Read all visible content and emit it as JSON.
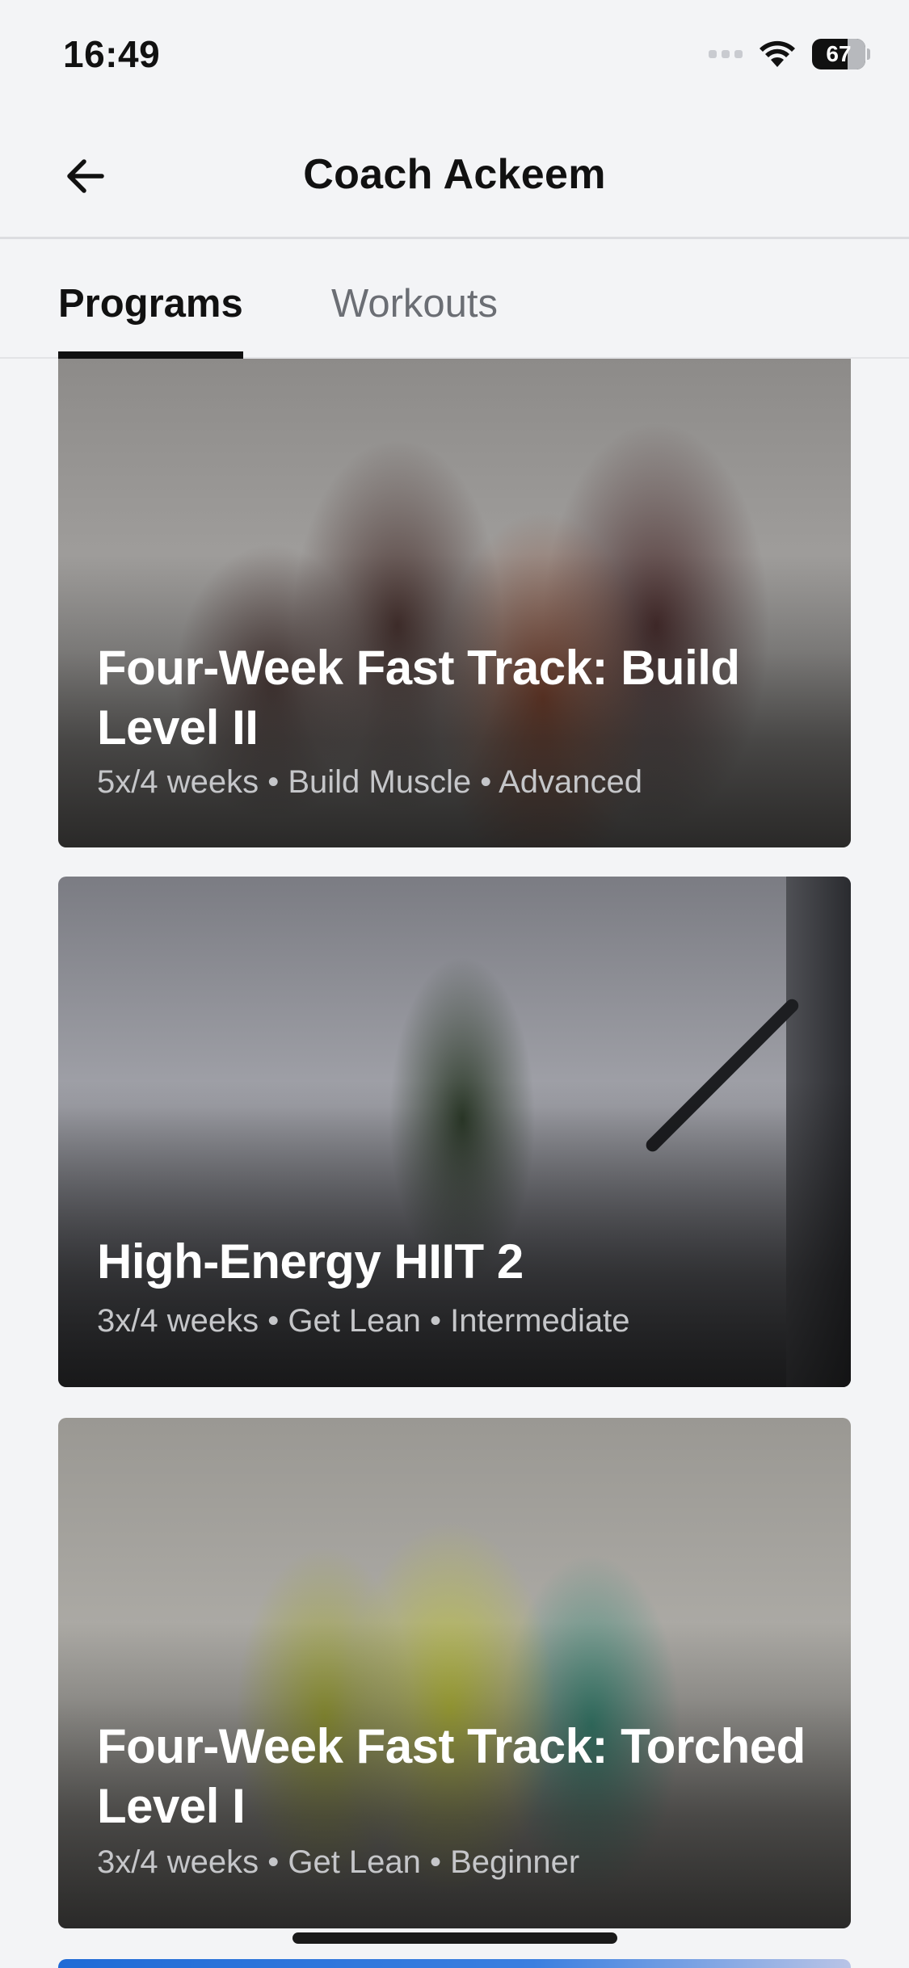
{
  "status_bar": {
    "time": "16:49",
    "battery": "67",
    "icons": [
      "cellular-signal-icon",
      "wifi-icon",
      "battery-icon"
    ]
  },
  "header": {
    "title": "Coach Ackeem",
    "back_icon": "arrow-left-icon"
  },
  "tabs": [
    {
      "label": "Programs",
      "active": true
    },
    {
      "label": "Workouts",
      "active": false
    }
  ],
  "programs": [
    {
      "title": "Four-Week Fast Track: Build Level II",
      "meta": "5x/4 weeks • Build Muscle • Advanced"
    },
    {
      "title": "High-Energy HIIT 2",
      "meta": "3x/4 weeks • Get Lean • Intermediate"
    },
    {
      "title": "Four-Week Fast Track: Torched Level I",
      "meta": "3x/4 weeks • Get Lean • Beginner"
    }
  ],
  "colors": {
    "background": "#f3f4f6",
    "active_tab": "#111111",
    "inactive_tab": "#6b6e74"
  }
}
